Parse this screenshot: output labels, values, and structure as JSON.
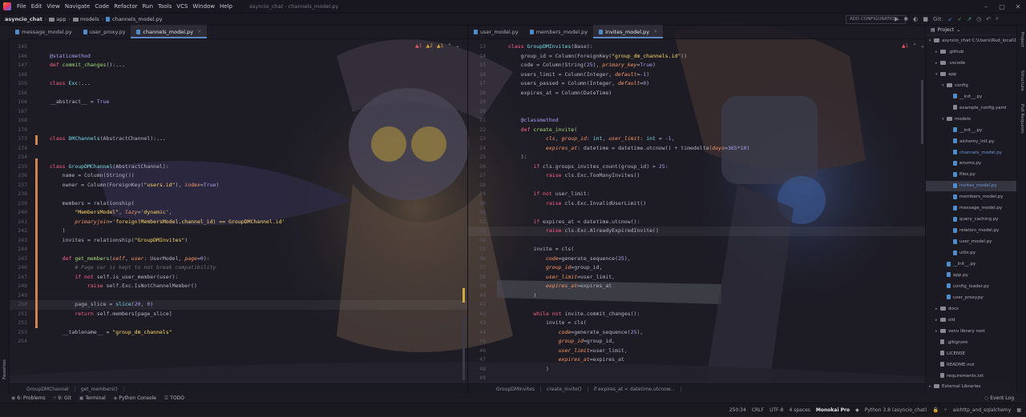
{
  "menubar": {
    "items": [
      "File",
      "Edit",
      "View",
      "Navigate",
      "Code",
      "Refactor",
      "Run",
      "Tools",
      "VCS",
      "Window",
      "Help"
    ],
    "title": "asyncio_chat - channels_model.py"
  },
  "navbar": {
    "crumbs": [
      "asyncio_chat",
      "app",
      "models",
      "channels_model.py"
    ],
    "run_config": "ADD CONFIGURATION...",
    "vcs": "Git:"
  },
  "left_tabs": [
    {
      "label": "message_model.py"
    },
    {
      "label": "user_proxy.py"
    },
    {
      "label": "channels_model.py",
      "active": true
    }
  ],
  "right_tabs": [
    {
      "label": "user_model.py"
    },
    {
      "label": "members_model.py"
    },
    {
      "label": "invites_model.py",
      "active": true
    }
  ],
  "left_inspections": {
    "errors": "1",
    "warnings": "2",
    "weak": "1"
  },
  "right_inspections": {
    "errors": "1"
  },
  "left_lines": [
    {
      "n": "145",
      "html": ""
    },
    {
      "n": "146",
      "html": "<span class='dec'>@staticmethod</span>"
    },
    {
      "n": "147",
      "html": "<span class='kw'>def</span> <span class='fn'>commit_changes</span>():<span class='tx'>...</span>"
    },
    {
      "n": "148",
      "html": ""
    },
    {
      "n": "155",
      "html": "<span class='kw'>class</span> <span class='cl'>Exc</span>:<span class='tx'>...</span>"
    },
    {
      "n": "156",
      "html": ""
    },
    {
      "n": "166",
      "html": "__abstract__ = <span class='nu'>True</span>"
    },
    {
      "n": "167",
      "html": ""
    },
    {
      "n": "168",
      "html": ""
    },
    {
      "n": "170",
      "html": ""
    },
    {
      "n": "173",
      "html": "<span class='kw'>class</span> <span class='cl'>DMChannels</span>(AbstractChannel):<span class='tx'>...</span>"
    },
    {
      "n": "174",
      "html": ""
    },
    {
      "n": "234",
      "html": ""
    },
    {
      "n": "235",
      "html": "<span class='kw'>class</span> <span class='cl'>GroupDMChannel</span>(AbstractChannel):"
    },
    {
      "n": "236",
      "html": "    name = Column(String())"
    },
    {
      "n": "237",
      "html": "    owner = Column(ForeignKey(<span class='st'>\"users.id\"</span>), <span class='it'>index</span>=<span class='nu'>True</span>)"
    },
    {
      "n": "238",
      "html": ""
    },
    {
      "n": "239",
      "html": "    members = relationship("
    },
    {
      "n": "240",
      "html": "        <span class='st'>\"MembersModel\"</span>, <span class='it'>lazy</span>=<span class='st'>'dynamic'</span>,"
    },
    {
      "n": "241",
      "html": "        <span class='it'>primaryjoin</span>=<span class='st'>'foreign(MembersModel.channel_id) == GroupDMChannel.id'</span>"
    },
    {
      "n": "242",
      "html": "    )"
    },
    {
      "n": "243",
      "html": "    invites = relationship(<span class='st'>\"GroupDMInvites\"</span>)"
    },
    {
      "n": "244",
      "html": ""
    },
    {
      "n": "245",
      "html": "    <span class='kw'>def</span> <span class='fn'>get_members</span>(<span class='it'>self</span>, <span class='it'>user</span>: UserModel, <span class='it'>page</span>=<span class='nu'>0</span>):"
    },
    {
      "n": "246",
      "html": "        <span class='cm'># Page var is kept to not break compatibility</span>"
    },
    {
      "n": "247",
      "html": "        <span class='kw'>if not</span> self.is_user_member(user):"
    },
    {
      "n": "248",
      "html": "            <span class='kw'>raise</span> self.Exc.IsNotChannelMember()"
    },
    {
      "n": "249",
      "html": ""
    },
    {
      "n": "250",
      "html": "        page_slice = <span class='cl'>slice</span>(<span class='nu'>20</span>, <span class='nu'>0</span>)",
      "cur": true
    },
    {
      "n": "251",
      "html": "        <span class='kw'>return</span> self.members[page_slice]"
    },
    {
      "n": "252",
      "html": ""
    },
    {
      "n": "253",
      "html": "    __tablename__ = <span class='st'>\"group_dm_channels\"</span>"
    },
    {
      "n": "254",
      "html": ""
    }
  ],
  "right_lines": [
    {
      "n": "13",
      "html": "<span class='kw'>class</span> <span class='cl'>GroupDMInvites</span>(Base):"
    },
    {
      "n": "14",
      "html": "    group_id = Column(ForeignKey(<span class='st'>\"group_dm_channels.id\"</span>))"
    },
    {
      "n": "15",
      "html": "    code = Column(String(<span class='nu'>25</span>), <span class='it'>primary_key</span>=<span class='nu'>True</span>)"
    },
    {
      "n": "16",
      "html": "    users_limit = Column(Integer, <span class='it'>default</span>=<span class='nu'>-1</span>)"
    },
    {
      "n": "17",
      "html": "    users_passed = Column(Integer, <span class='it'>default</span>=<span class='nu'>0</span>)"
    },
    {
      "n": "18",
      "html": "    expires_at = Column(DateTime)"
    },
    {
      "n": "19",
      "html": ""
    },
    {
      "n": "20",
      "html": ""
    },
    {
      "n": "21",
      "html": "    <span class='dec'>@classmethod</span>"
    },
    {
      "n": "22",
      "html": "    <span class='kw'>def</span> <span class='fn'>create_invite</span>("
    },
    {
      "n": "23",
      "html": "            <span class='it'>cls</span>, <span class='it'>group_id</span>: <span class='cl'>int</span>, <span class='it'>user_limit</span>: <span class='cl'>int</span> = <span class='nu'>-1</span>,"
    },
    {
      "n": "24",
      "html": "            <span class='it'>expires_at</span>: datetime = datetime.utcnow() + timedelta(<span class='it'>days</span>=<span class='nu'>365</span>*<span class='nu'>10</span>)"
    },
    {
      "n": "25",
      "html": "    ):"
    },
    {
      "n": "26",
      "html": "        <span class='kw'>if</span> cls.groups_invites_count(group_id) > <span class='nu'>25</span>:"
    },
    {
      "n": "27",
      "html": "            <span class='kw'>raise</span> cls.Exc.TooManyInvites()"
    },
    {
      "n": "28",
      "html": ""
    },
    {
      "n": "29",
      "html": "        <span class='kw'>if not</span> user_limit:"
    },
    {
      "n": "30",
      "html": "            <span class='kw'>raise</span> cls.Exc.InvalidUserLimit()"
    },
    {
      "n": "31",
      "html": ""
    },
    {
      "n": "32",
      "html": "        <span class='kw'>if</span> expires_at < datetime.utcnow():"
    },
    {
      "n": "33",
      "html": "            <span class='kw'>raise</span> cls.Exc.AlreadyExpiredInvite()",
      "cur": true
    },
    {
      "n": "34",
      "html": ""
    },
    {
      "n": "35",
      "html": "        invite = cls("
    },
    {
      "n": "36",
      "html": "            <span class='it'>code</span>=generate_sequence(<span class='nu'>25</span>),"
    },
    {
      "n": "37",
      "html": "            <span class='it'>group_id</span>=group_id,"
    },
    {
      "n": "38",
      "html": "            <span class='it'>user_limit</span>=user_limit,"
    },
    {
      "n": "39",
      "html": "            <span class='it'>expires_at</span>=expires_at"
    },
    {
      "n": "40",
      "html": "        )"
    },
    {
      "n": "41",
      "html": ""
    },
    {
      "n": "42",
      "html": "        <span class='kw'>while not</span> invite.commit_changes():"
    },
    {
      "n": "43",
      "html": "            invite = cls("
    },
    {
      "n": "44",
      "html": "                <span class='it'>code</span>=generate_sequence(<span class='nu'>25</span>),"
    },
    {
      "n": "45",
      "html": "                <span class='it'>group_id</span>=group_id,"
    },
    {
      "n": "46",
      "html": "                <span class='it'>user_limit</span>=user_limit,"
    },
    {
      "n": "47",
      "html": "                <span class='it'>expires_at</span>=expires_at"
    },
    {
      "n": "48",
      "html": "            )"
    },
    {
      "n": "49",
      "html": ""
    }
  ],
  "left_crumb": [
    "GroupDMChannel",
    "get_members()"
  ],
  "right_crumb": [
    "GroupDMInvites",
    "create_invite()",
    "if expires_at < datetime.utcnow..."
  ],
  "project": {
    "title": "Project",
    "items": [
      {
        "label": "asyncio_chat  C:\\Users\\Rud_local\\Docu",
        "d": 0,
        "t": "folder",
        "open": true
      },
      {
        "label": ".github",
        "d": 1,
        "t": "folder"
      },
      {
        "label": ".vscode",
        "d": 1,
        "t": "folder"
      },
      {
        "label": "app",
        "d": 1,
        "t": "folder",
        "open": true
      },
      {
        "label": "config",
        "d": 2,
        "t": "folder",
        "open": true
      },
      {
        "label": "__init__.py",
        "d": 3,
        "t": "py"
      },
      {
        "label": "example_config.yaml",
        "d": 3,
        "t": "file"
      },
      {
        "label": "models",
        "d": 2,
        "t": "folder",
        "open": true
      },
      {
        "label": "__init__.py",
        "d": 3,
        "t": "py"
      },
      {
        "label": "alchemy_init.py",
        "d": 3,
        "t": "py"
      },
      {
        "label": "channels_model.py",
        "d": 3,
        "t": "py",
        "mod": true
      },
      {
        "label": "enums.py",
        "d": 3,
        "t": "py"
      },
      {
        "label": "files.py",
        "d": 3,
        "t": "py"
      },
      {
        "label": "invites_model.py",
        "d": 3,
        "t": "py",
        "mod": true,
        "sel": true
      },
      {
        "label": "members_model.py",
        "d": 3,
        "t": "py"
      },
      {
        "label": "message_model.py",
        "d": 3,
        "t": "py"
      },
      {
        "label": "query_caching.py",
        "d": 3,
        "t": "py"
      },
      {
        "label": "relation_model.py",
        "d": 3,
        "t": "py"
      },
      {
        "label": "user_model.py",
        "d": 3,
        "t": "py"
      },
      {
        "label": "utils.py",
        "d": 3,
        "t": "py"
      },
      {
        "label": "__init__.py",
        "d": 2,
        "t": "py"
      },
      {
        "label": "app.py",
        "d": 2,
        "t": "py"
      },
      {
        "label": "config_loader.py",
        "d": 2,
        "t": "py"
      },
      {
        "label": "user_proxy.py",
        "d": 2,
        "t": "py"
      },
      {
        "label": "docs",
        "d": 1,
        "t": "folder"
      },
      {
        "label": "old",
        "d": 1,
        "t": "folder"
      },
      {
        "label": "venv  library root",
        "d": 1,
        "t": "folder"
      },
      {
        "label": ".gitignore",
        "d": 1,
        "t": "file"
      },
      {
        "label": "LICENSE",
        "d": 1,
        "t": "file"
      },
      {
        "label": "README.md",
        "d": 1,
        "t": "file"
      },
      {
        "label": "requirements.txt",
        "d": 1,
        "t": "file"
      },
      {
        "label": "External Libraries",
        "d": 0,
        "t": "folder"
      }
    ]
  },
  "right_sidebar": [
    "Project",
    "Structure",
    "Pull Requests"
  ],
  "left_sidebar": [
    "Favorites"
  ],
  "toolwindows": [
    {
      "key": "6:",
      "label": "Problems"
    },
    {
      "key": "9:",
      "label": "Git"
    },
    {
      "key": "",
      "label": "Terminal"
    },
    {
      "key": "",
      "label": "Python Console"
    },
    {
      "key": "",
      "label": "TODO"
    }
  ],
  "event_log": "Event Log",
  "status": {
    "position": "250:34",
    "line_sep": "CRLF",
    "encoding": "UTF-8",
    "indent": "4 spaces",
    "theme": "Monokai Pro",
    "interpreter": "Python 3.8 (asyncio_chat)",
    "branch": "aiohttp_and_sqlalchemy"
  },
  "colors": {
    "accent": "#5a87c6",
    "changed": "#d08550",
    "warning": "#d4a843"
  }
}
